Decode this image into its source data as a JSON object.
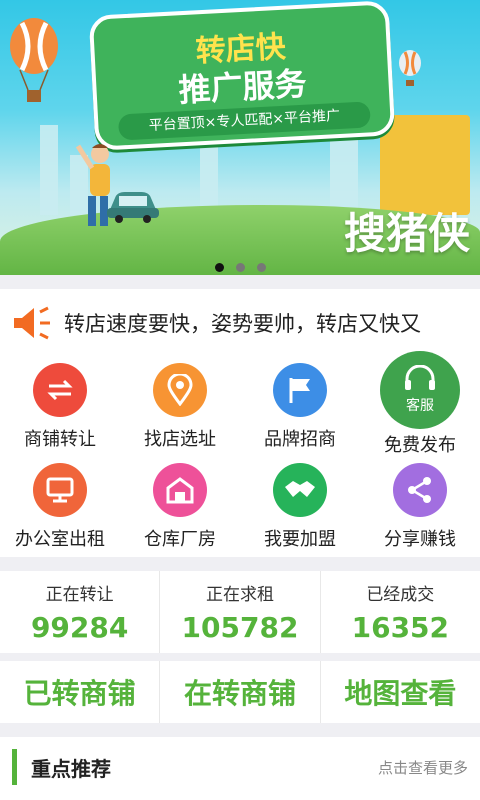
{
  "banner": {
    "sign_line1": "转店快",
    "sign_line2": "推广服务",
    "sign_line3": "平台置顶×专人匹配×平台推广",
    "brand": "搜猪侠",
    "slide_count": 3,
    "active_slide": 1
  },
  "notice": {
    "icon": "speaker-icon",
    "text": "转店速度要快，姿势要帅，转店又快又"
  },
  "grid": [
    {
      "label": "商铺转让",
      "icon": "transfer-icon",
      "color": "#ee4b3c"
    },
    {
      "label": "找店选址",
      "icon": "location-pin-icon",
      "color": "#f79433"
    },
    {
      "label": "品牌招商",
      "icon": "flag-icon",
      "color": "#3d8ee6"
    },
    {
      "label": "免费发布",
      "icon": "headset-icon",
      "color": "#3fa34d",
      "badge": "客服"
    },
    {
      "label": "办公室出租",
      "icon": "monitor-icon",
      "color": "#f0653a"
    },
    {
      "label": "仓库厂房",
      "icon": "warehouse-icon",
      "color": "#ee5199"
    },
    {
      "label": "我要加盟",
      "icon": "handshake-icon",
      "color": "#26b35a"
    },
    {
      "label": "分享赚钱",
      "icon": "share-icon",
      "color": "#a26ee0"
    }
  ],
  "stats": [
    {
      "title": "正在转让",
      "value": "99284"
    },
    {
      "title": "正在求租",
      "value": "105782"
    },
    {
      "title": "已经成交",
      "value": "16352"
    }
  ],
  "links": [
    "已转商铺",
    "在转商铺",
    "地图查看"
  ],
  "recommend": {
    "title": "重点推荐",
    "more": "点击查看更多"
  },
  "colors": {
    "accent_green": "#55b33b",
    "divider": "#efeff3"
  }
}
